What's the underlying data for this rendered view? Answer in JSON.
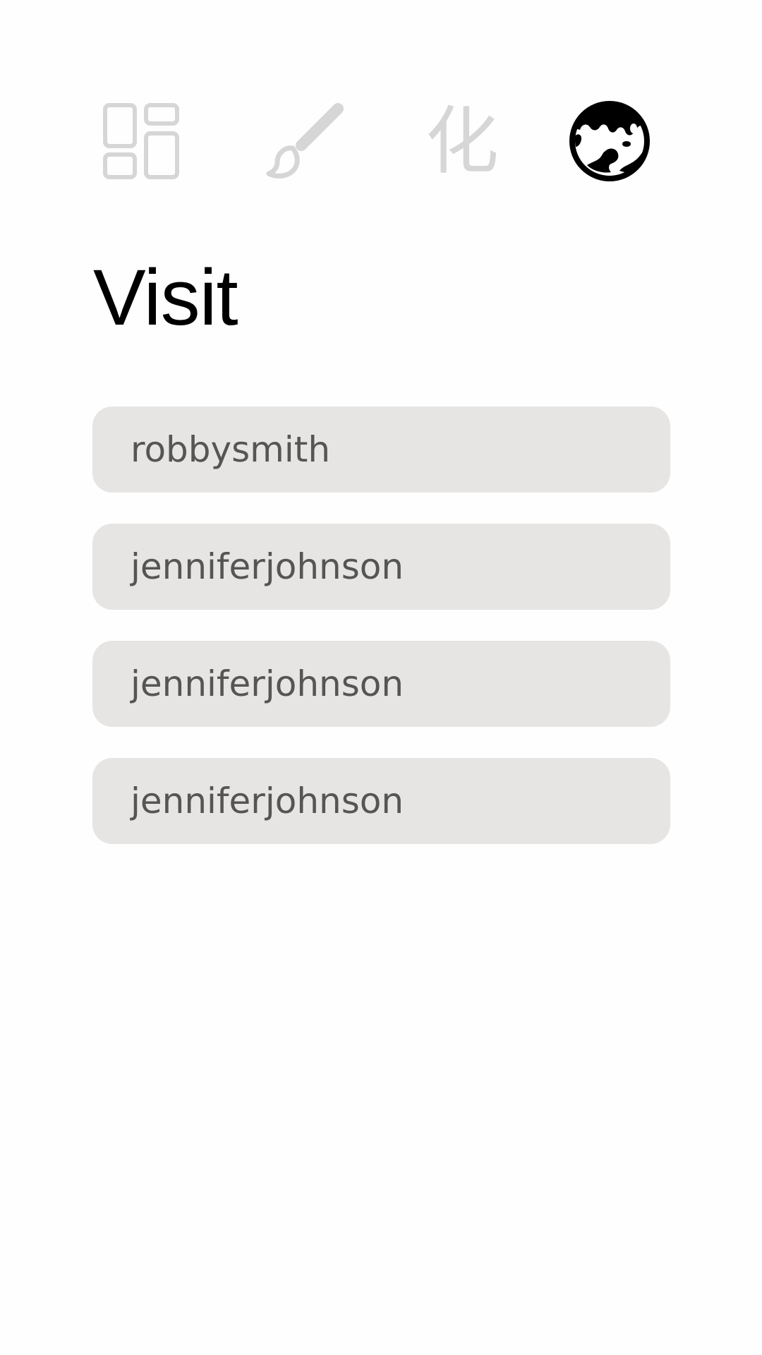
{
  "nav": {
    "items": [
      {
        "name": "dashboard",
        "icon": "dashboard-grid-icon",
        "active": false
      },
      {
        "name": "brush",
        "icon": "paintbrush-icon",
        "active": false
      },
      {
        "name": "transform",
        "icon": "kanji-hua-icon",
        "glyph": "化",
        "active": false
      },
      {
        "name": "visit",
        "icon": "globe-icon",
        "active": true
      }
    ],
    "inactive_color": "#d6d6d6",
    "active_color": "#000000"
  },
  "title": "Visit",
  "visits": [
    {
      "username": "robbysmith"
    },
    {
      "username": "jenniferjohnson"
    },
    {
      "username": "jenniferjohnson"
    },
    {
      "username": "jenniferjohnson"
    }
  ],
  "colors": {
    "background": "#fefefe",
    "item_background": "#e6e5e4",
    "item_text": "#555555",
    "title_text": "#000000"
  }
}
